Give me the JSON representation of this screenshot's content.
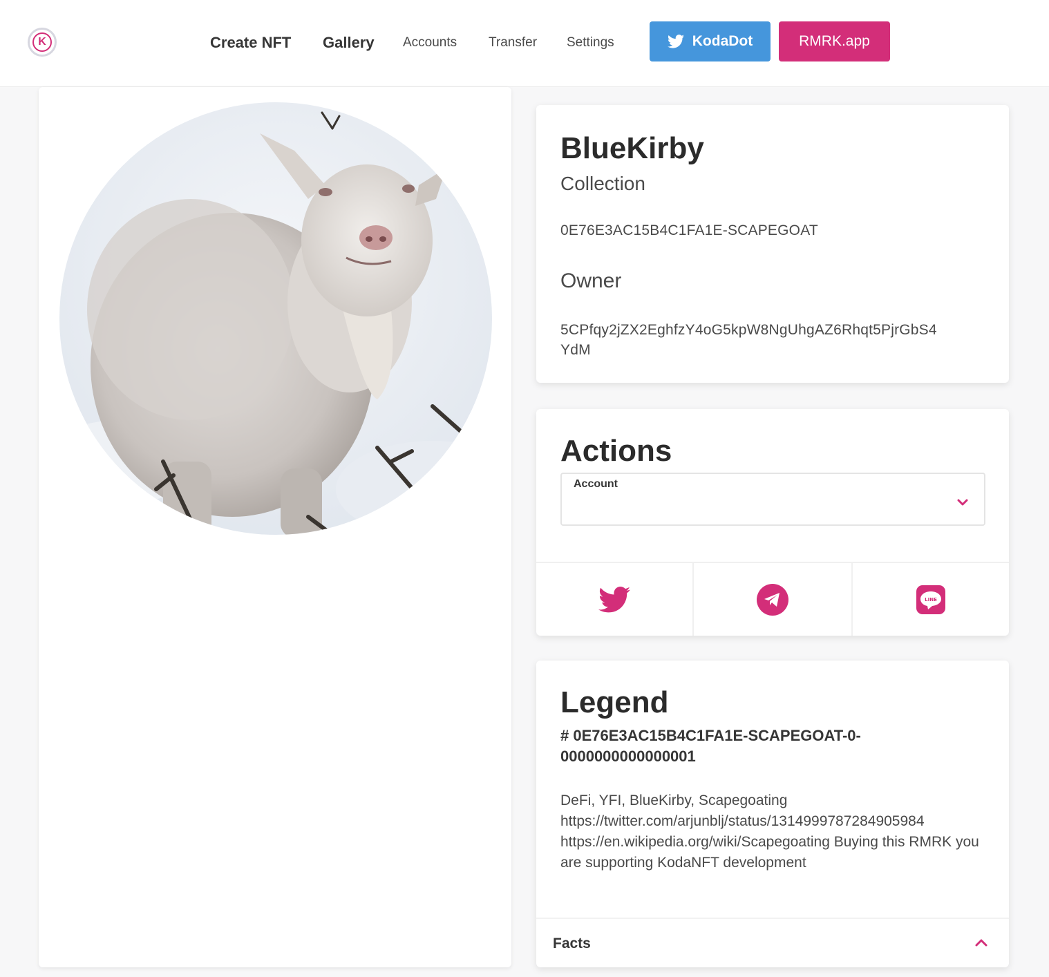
{
  "nav": {
    "logo_letter": "K",
    "links": [
      "Create NFT",
      "Gallery",
      "Accounts",
      "Transfer",
      "Settings"
    ],
    "twitter_button": "KodaDot",
    "rmrk_button": "RMRK.app"
  },
  "nft": {
    "name": "BlueKirby",
    "collection_label": "Collection",
    "collection_id": "0E76E3AC15B4C1FA1E-SCAPEGOAT",
    "owner_label": "Owner",
    "owner_line1": "5CPfqy2jZX2EghfzY4oG5kpW8NgUhgAZ6Rhqt5PjrGbS4",
    "owner_line2": "YdM"
  },
  "actions": {
    "title": "Actions",
    "account_label": "Account",
    "share": [
      "twitter-icon",
      "telegram-icon",
      "line-icon"
    ]
  },
  "legend": {
    "title": "Legend",
    "id_line1": "# 0E76E3AC15B4C1FA1E-SCAPEGOAT-0-",
    "id_line2": "0000000000000001",
    "description": "DeFi, YFI, BlueKirby, Scapegoating https://twitter.com/arjunblj/status/1314999787284905984 https://en.wikipedia.org/wiki/Scapegoating Buying this RMRK you are supporting KodaNFT development",
    "facts_label": "Facts"
  },
  "colors": {
    "accent": "#d32e79",
    "twitter": "#4596dc"
  }
}
